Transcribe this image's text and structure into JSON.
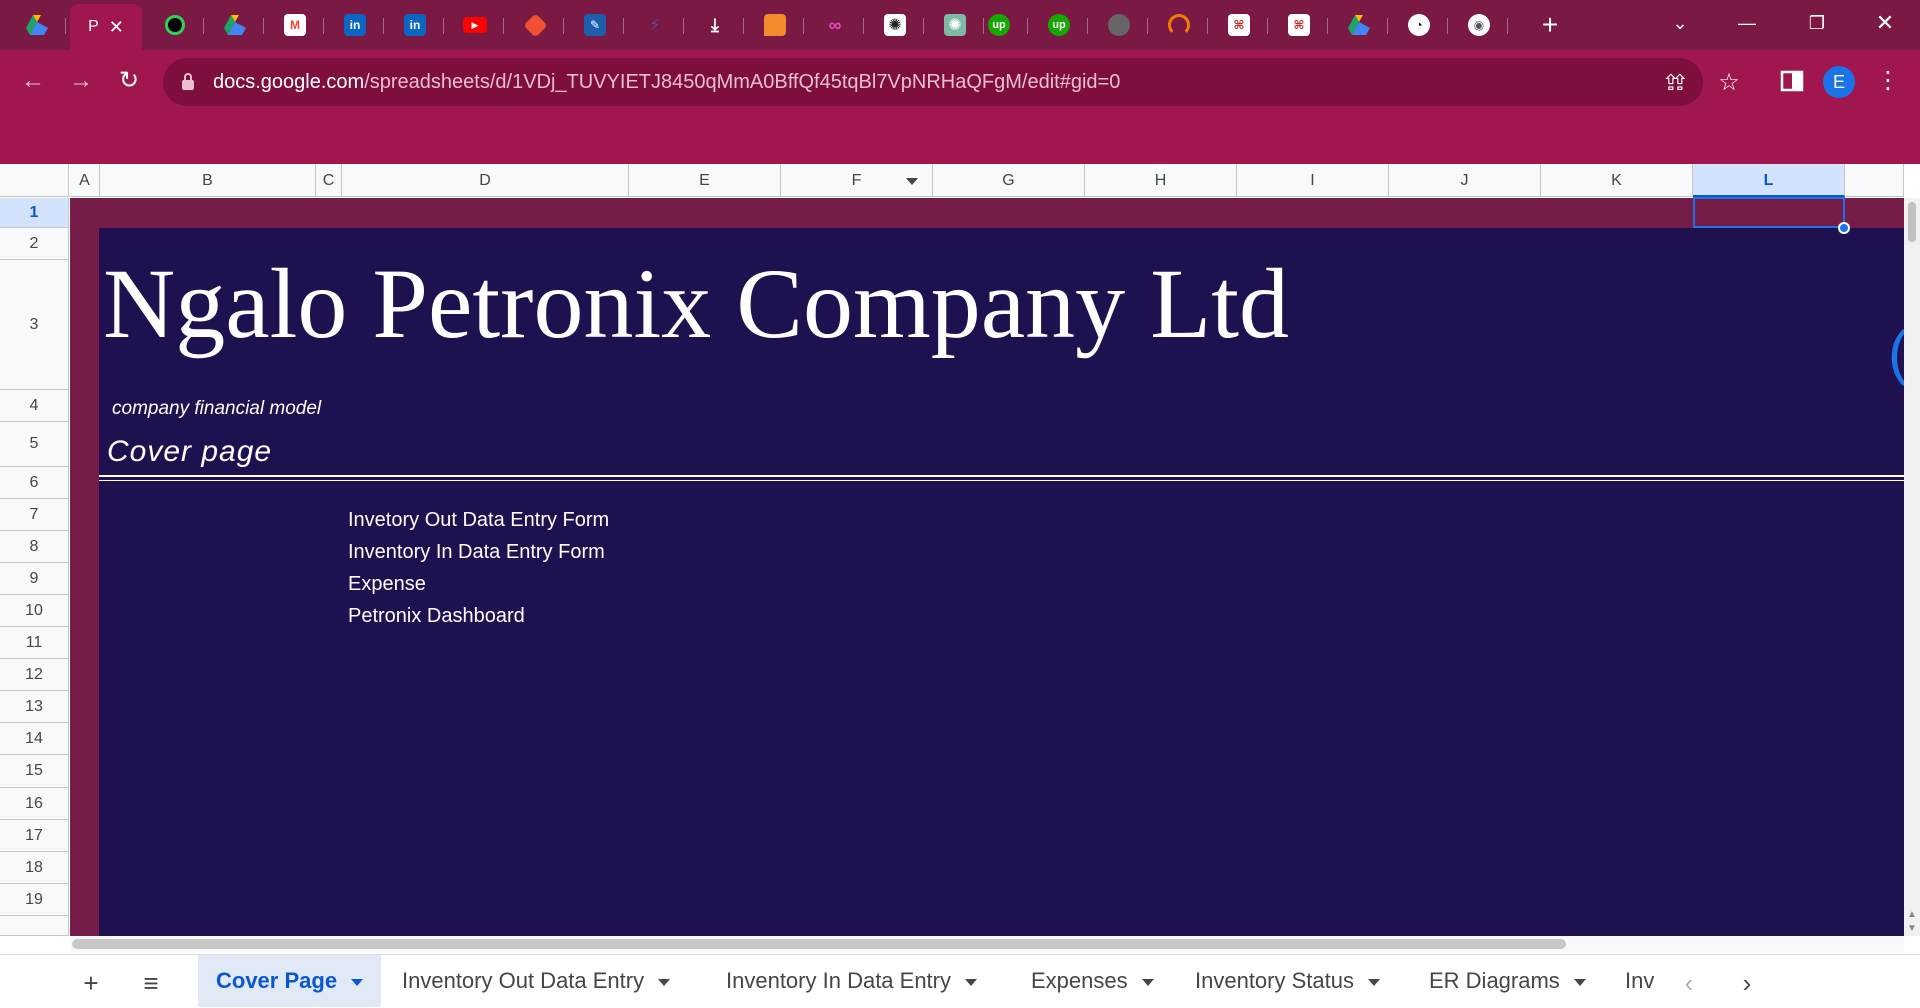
{
  "browser": {
    "tabs": [
      {
        "icon": "google-drive-icon",
        "color": "#1fa463"
      },
      {
        "icon": "active-tab",
        "label": "P",
        "active": true
      },
      {
        "icon": "circle-ring-icon",
        "color": "#2fd158"
      },
      {
        "icon": "google-drive-icon",
        "color": "#1fa463"
      },
      {
        "icon": "gmail-icon",
        "label": "M",
        "color": "#ea4335"
      },
      {
        "icon": "linkedin-icon",
        "label": "in",
        "color": "#0a66c2"
      },
      {
        "icon": "linkedin-icon",
        "label": "in",
        "color": "#0a66c2"
      },
      {
        "icon": "youtube-icon",
        "label": "▶",
        "color": "#ff0000"
      },
      {
        "icon": "git-icon",
        "label": "◆",
        "color": "#f05133"
      },
      {
        "icon": "feather-icon",
        "label": "✎",
        "color": "#1b5fad"
      },
      {
        "icon": "bolt-icon",
        "label": "⚡",
        "color": "#4a3a8a"
      },
      {
        "icon": "download-icon",
        "label": "⤓",
        "color": "#7a1a44"
      },
      {
        "icon": "chat-bubble-icon",
        "label": "▮",
        "color": "#f28b2e"
      },
      {
        "icon": "glasses-icon",
        "label": "∞",
        "color": "#e04cb5"
      },
      {
        "icon": "openai-icon",
        "label": "✺",
        "color": "#ffffff"
      },
      {
        "icon": "openai-icon",
        "label": "✺",
        "color": "#7fb9a5"
      },
      {
        "icon": "upwork-icon",
        "label": "up",
        "color": "#14a800"
      },
      {
        "icon": "upwork-icon",
        "label": "up",
        "color": "#14a800"
      },
      {
        "icon": "globe-icon",
        "label": "◍",
        "color": "#666666"
      },
      {
        "icon": "loading-ring-icon",
        "label": "◠",
        "color": "#f57c00"
      },
      {
        "icon": "redline-doc-icon",
        "label": "⌘",
        "color": "#ffffff"
      },
      {
        "icon": "redline-doc-icon",
        "label": "⌘",
        "color": "#ffffff"
      },
      {
        "icon": "google-drive-icon",
        "color": "#1fa463"
      },
      {
        "icon": "gauge-icon",
        "label": "◔",
        "color": "#ffffff"
      },
      {
        "icon": "chrome-icon",
        "label": "◉",
        "color": "#ffffff"
      }
    ],
    "active_tab_label": "P",
    "url_host": "docs.google.com",
    "url_path": "/spreadsheets/d/1VDj_TUVYIETJ8450qMmA0BffQf45tqBl7VpNRHaQFgM/edit#gid=0",
    "profile_initial": "E",
    "colors": {
      "tabstrip": "#7a1a44",
      "toolbar": "#a0174f",
      "omnibox": "#7e0e3e"
    }
  },
  "sheet": {
    "columns": [
      "A",
      "B",
      "C",
      "D",
      "E",
      "F",
      "G",
      "H",
      "I",
      "J",
      "K",
      "L"
    ],
    "selected_column": "L",
    "selected_row": "1",
    "rows": [
      "1",
      "2",
      "3",
      "4",
      "5",
      "6",
      "7",
      "8",
      "9",
      "10",
      "11",
      "12",
      "13",
      "14",
      "15",
      "16",
      "17",
      "18",
      "19"
    ],
    "content": {
      "title": "Ngalo Petronix Company Ltd",
      "subtitle": "company financial model",
      "cover_label": "Cover page",
      "links": [
        "Invetory Out Data Entry Form",
        "Inventory In Data Entry Form",
        "Expense",
        "Petronix Dashboard"
      ]
    },
    "colors": {
      "background": "#1f1150",
      "accent_band": "#761c48",
      "text": "#ffffff",
      "selection": "#1a73e8"
    }
  },
  "sheet_tabs": {
    "tabs": [
      {
        "label": "Cover Page",
        "active": true
      },
      {
        "label": "Inventory Out Data Entry"
      },
      {
        "label": "Inventory In Data Entry"
      },
      {
        "label": "Expenses"
      },
      {
        "label": "Inventory Status"
      },
      {
        "label": "ER Diagrams"
      },
      {
        "label": "Inv"
      }
    ]
  }
}
